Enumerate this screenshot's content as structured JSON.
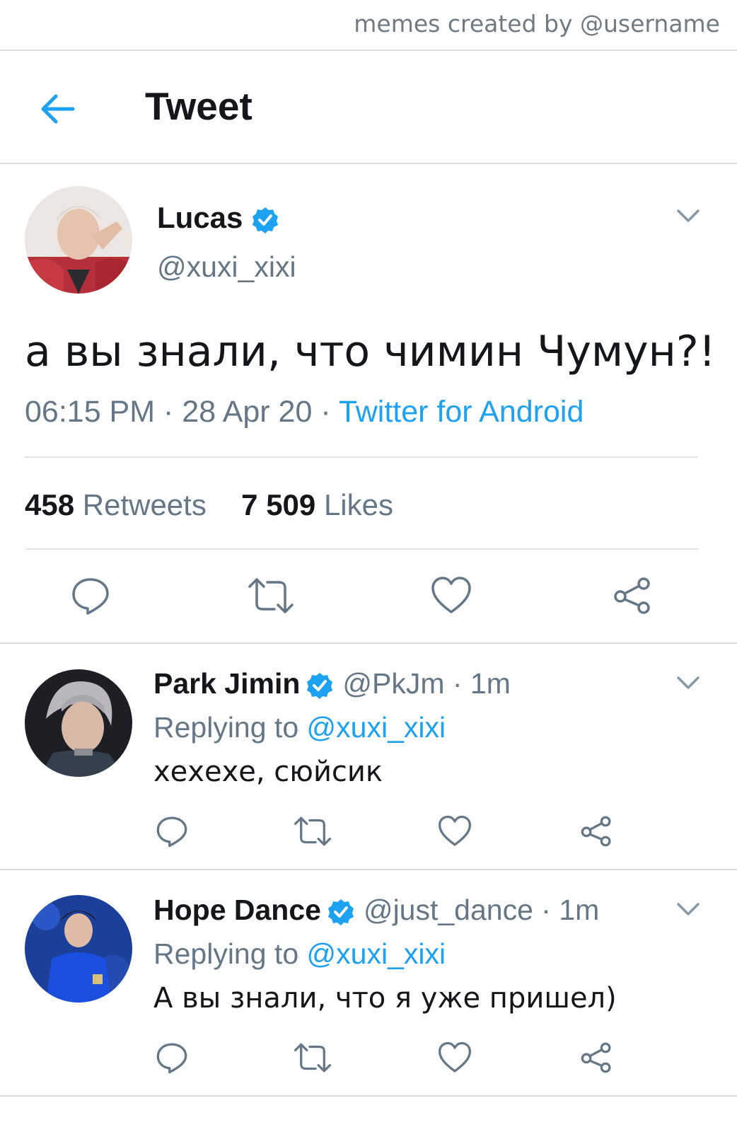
{
  "watermark": "memes created by @username",
  "header": {
    "title": "Tweet",
    "back_icon": "arrow-left-icon"
  },
  "colors": {
    "accent": "#1da1f2",
    "secondary_text": "#657786",
    "primary_text": "#14171a",
    "divider": "#e1e5e8"
  },
  "main_tweet": {
    "name": "Lucas",
    "handle": "@xuxi_xixi",
    "text": "а вы знали, что чимин Чумун?!",
    "time": "06:15 PM",
    "date": "28 Apr 20",
    "source": "Twitter for Android",
    "retweets_count": "458",
    "retweets_label": "Retweets",
    "likes_count": "7 509",
    "likes_label": "Likes"
  },
  "replies": [
    {
      "name": "Park Jimin",
      "handle": "@PkJm",
      "time": "1m",
      "replying_to_label": "Replying to",
      "replying_to": "@xuxi_xixi",
      "text": "хехехе, сюйсик"
    },
    {
      "name": "Hope Dance",
      "handle": "@just_dance",
      "time": "1m",
      "replying_to_label": "Replying to",
      "replying_to": "@xuxi_xixi",
      "text": "А вы знали, что я уже пришел)"
    }
  ],
  "separator": "·"
}
